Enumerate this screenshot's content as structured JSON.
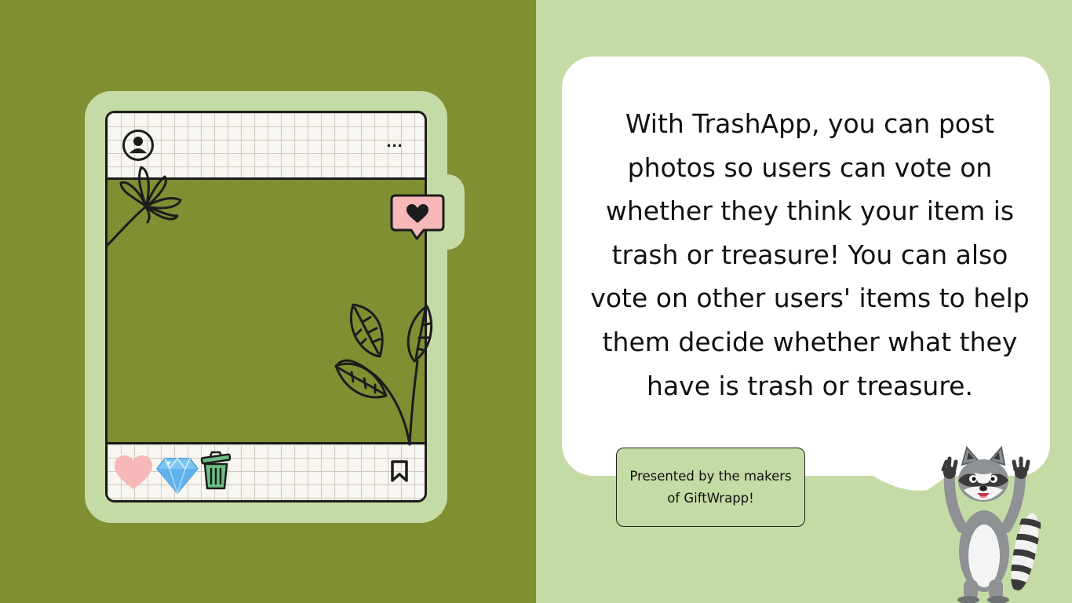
{
  "slide": {
    "description_text": "With TrashApp, you can post photos so users can vote on whether they think your item is trash or treasure! You can also vote on other users' items to help them decide whether what they have is trash or treasure.",
    "presented_by": "Presented by the makers of GiftWrapp!"
  },
  "post_mockup": {
    "more_label": "..."
  },
  "icons": {
    "profile": "user-circle-icon",
    "more": "more-dots-icon",
    "like_notification": "heart-speech-bubble-icon",
    "heart": "heart-icon",
    "gem": "diamond-icon",
    "trash": "trash-can-icon",
    "bookmark": "bookmark-icon",
    "flower": "flower-doodle",
    "leaves": "leaves-doodle",
    "mascot": "raccoon-mascot"
  },
  "colors": {
    "left_bg": "#7f8f32",
    "right_bg": "#c5dba5",
    "bubble_bg": "#ffffff",
    "heart_pink": "#f6b8b9",
    "gem_blue": "#7cc4f2",
    "trash_green": "#6dbf84",
    "outline": "#1c1c1c"
  }
}
